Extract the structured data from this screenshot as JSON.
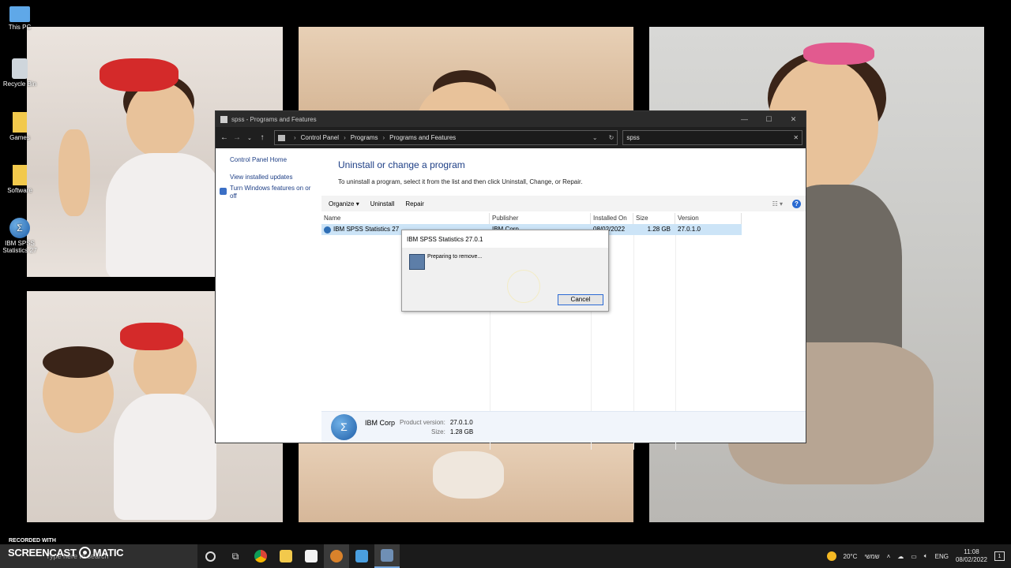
{
  "desktop": {
    "icons": [
      {
        "label": "This PC"
      },
      {
        "label": "Recycle Bin"
      },
      {
        "label": "Games"
      },
      {
        "label": "Software"
      },
      {
        "label": "IBM SPSS Statistics 27"
      }
    ]
  },
  "window": {
    "title": "spss - Programs and Features",
    "controls": {
      "minimize": "—",
      "maximize": "☐",
      "close": "✕"
    },
    "breadcrumb": [
      "Control Panel",
      "Programs",
      "Programs and Features"
    ],
    "search_value": "spss",
    "left_pane": {
      "home": "Control Panel Home",
      "updates": "View installed updates",
      "features": "Turn Windows features on or off"
    },
    "heading": "Uninstall or change a program",
    "subheading": "To uninstall a program, select it from the list and then click Uninstall, Change, or Repair.",
    "toolbar": {
      "organize": "Organize",
      "uninstall": "Uninstall",
      "repair": "Repair"
    },
    "columns": [
      "Name",
      "Publisher",
      "Installed On",
      "Size",
      "Version"
    ],
    "rows": [
      {
        "name": "IBM SPSS Statistics 27",
        "publisher": "IBM Corp",
        "installed_on": "08/02/2022",
        "size": "1.28 GB",
        "version": "27.0.1.0"
      }
    ],
    "details": {
      "publisher": "IBM Corp",
      "product_version_label": "Product version:",
      "product_version": "27.0.1.0",
      "size_label": "Size:",
      "size": "1.28 GB"
    }
  },
  "dialog": {
    "title": "IBM SPSS Statistics 27.0.1",
    "message": "Preparing to remove...",
    "cancel": "Cancel"
  },
  "taskbar": {
    "search_placeholder": "Type here to search",
    "weather": "20°C",
    "weather_text": "שמשי",
    "language": "ENG",
    "time": "11:08",
    "date": "08/02/2022",
    "notification_count": "1"
  },
  "watermark": {
    "recorded": "RECORDED WITH",
    "brand": "SCREENCAST-O-MATIC"
  }
}
